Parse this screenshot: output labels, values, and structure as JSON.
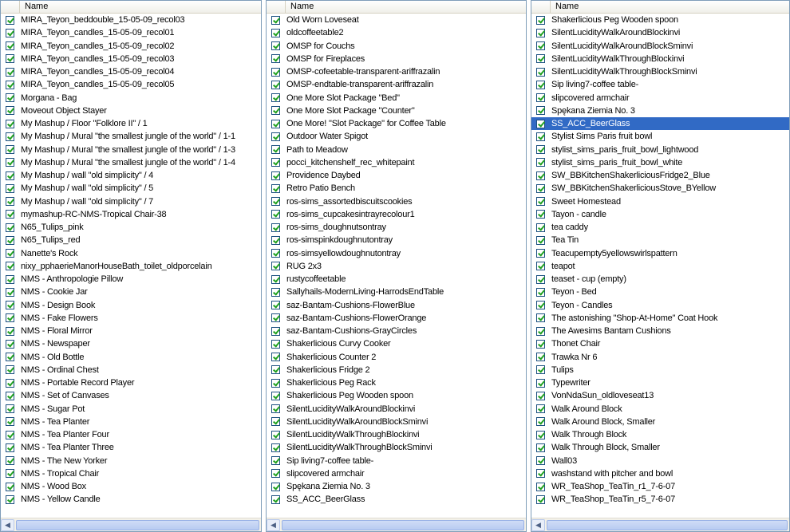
{
  "panels": [
    {
      "header": "Name",
      "items": [
        "MIRA_Teyon_beddouble_15-05-09_recol03",
        "MIRA_Teyon_candles_15-05-09_recol01",
        "MIRA_Teyon_candles_15-05-09_recol02",
        "MIRA_Teyon_candles_15-05-09_recol03",
        "MIRA_Teyon_candles_15-05-09_recol04",
        "MIRA_Teyon_candles_15-05-09_recol05",
        "Morgana - Bag",
        "Moveout Object Stayer",
        "My Mashup / Floor \"Folklore II\" / 1",
        "My Mashup / Mural \"the smallest jungle of the world\" / 1-1",
        "My Mashup / Mural \"the smallest jungle of the world\" / 1-3",
        "My Mashup / Mural \"the smallest jungle of the world\" / 1-4",
        "My Mashup / wall \"old simplicity\" / 4",
        "My Mashup / wall \"old simplicity\" / 5",
        "My Mashup / wall \"old simplicity\" / 7",
        "mymashup-RC-NMS-Tropical Chair-38",
        "N65_Tulips_pink",
        "N65_Tulips_red",
        "Nanette's Rock",
        "nixy_pphaerieManorHouseBath_toilet_oldporcelain",
        "NMS - Anthropologie Pillow",
        "NMS - Cookie Jar",
        "NMS - Design Book",
        "NMS - Fake Flowers",
        "NMS - Floral Mirror",
        "NMS - Newspaper",
        "NMS - Old Bottle",
        "NMS - Ordinal Chest",
        "NMS - Portable Record Player",
        "NMS - Set of Canvases",
        "NMS - Sugar Pot",
        "NMS - Tea Planter",
        "NMS - Tea Planter Four",
        "NMS - Tea Planter Three",
        "NMS - The New Yorker",
        "NMS - Tropical Chair",
        "NMS - Wood Box",
        "NMS - Yellow Candle"
      ],
      "selected": -1
    },
    {
      "header": "Name",
      "items": [
        "Old Worn Loveseat",
        "oldcoffeetable2",
        "OMSP for Couchs",
        "OMSP for Fireplaces",
        "OMSP-cofeetable-transparent-ariffrazalin",
        "OMSP-endtable-transparent-ariffrazalin",
        "One More Slot Package \"Bed\"",
        "One More Slot Package \"Counter\"",
        "One More! \"Slot Package\" for Coffee Table",
        "Outdoor Water Spigot",
        "Path to Meadow",
        "pocci_kitchenshelf_rec_whitepaint",
        "Providence Daybed",
        "Retro Patio Bench",
        "ros-sims_assortedbiscuitscookies",
        "ros-sims_cupcakesintrayrecolour1",
        "ros-sims_doughnutsontray",
        "ros-simspinkdoughnutontray",
        "ros-simsyellowdoughnutontray",
        "RUG 2x3",
        "rustycoffeetable",
        "Sallyhails-ModernLiving-HarrodsEndTable",
        "saz-Bantam-Cushions-FlowerBlue",
        "saz-Bantam-Cushions-FlowerOrange",
        "saz-Bantam-Cushions-GrayCircles",
        "Shakerlicious  Curvy Cooker",
        "Shakerlicious Counter 2",
        "Shakerlicious Fridge 2",
        "Shakerlicious Peg Rack",
        "Shakerlicious Peg Wooden spoon",
        "SilentLucidityWalkAroundBlockinvi",
        "SilentLucidityWalkAroundBlockSminvi",
        "SilentLucidityWalkThroughBlockinvi",
        "SilentLucidityWalkThroughBlockSminvi",
        "Sip living7-coffee table-",
        "slipcovered armchair",
        "Spękana Ziemia No. 3",
        "SS_ACC_BeerGlass"
      ],
      "selected": -1
    },
    {
      "header": "Name",
      "items": [
        "Shakerlicious Peg Wooden spoon",
        "SilentLucidityWalkAroundBlockinvi",
        "SilentLucidityWalkAroundBlockSminvi",
        "SilentLucidityWalkThroughBlockinvi",
        "SilentLucidityWalkThroughBlockSminvi",
        "Sip living7-coffee table-",
        "slipcovered armchair",
        "Spękana Ziemia No. 3",
        "SS_ACC_BeerGlass",
        "Stylist Sims Paris fruit bowl",
        "stylist_sims_paris_fruit_bowl_lightwood",
        "stylist_sims_paris_fruit_bowl_white",
        "SW_BBKitchenShakerliciousFridge2_Blue",
        "SW_BBKitchenShakerliciousStove_BYellow",
        "Sweet Homestead",
        "Tayon - candle",
        "tea caddy",
        "Tea Tin",
        "Teacupempty5yellowswirlspattern",
        "teapot",
        "teaset - cup (empty)",
        "Teyon - Bed",
        "Teyon - Candles",
        "The astonishing \"Shop-At-Home\" Coat Hook",
        "The Awesims Bantam Cushions",
        "Thonet Chair",
        "Trawka Nr 6",
        "Tulips",
        "Typewriter",
        "VonNdaSun_oldloveseat13",
        "Walk Around Block",
        "Walk Around Block, Smaller",
        "Walk Through Block",
        "Walk Through Block, Smaller",
        "Wall03",
        "washstand with pitcher and bowl",
        "WR_TeaShop_TeaTin_r1_7-6-07",
        "WR_TeaShop_TeaTin_r5_7-6-07"
      ],
      "selected": 8
    }
  ],
  "scroll_left_icon": "left-arrow-icon",
  "colors": {
    "selection": "#316ac5",
    "check": "#21a121",
    "border": "#7f9db9"
  }
}
